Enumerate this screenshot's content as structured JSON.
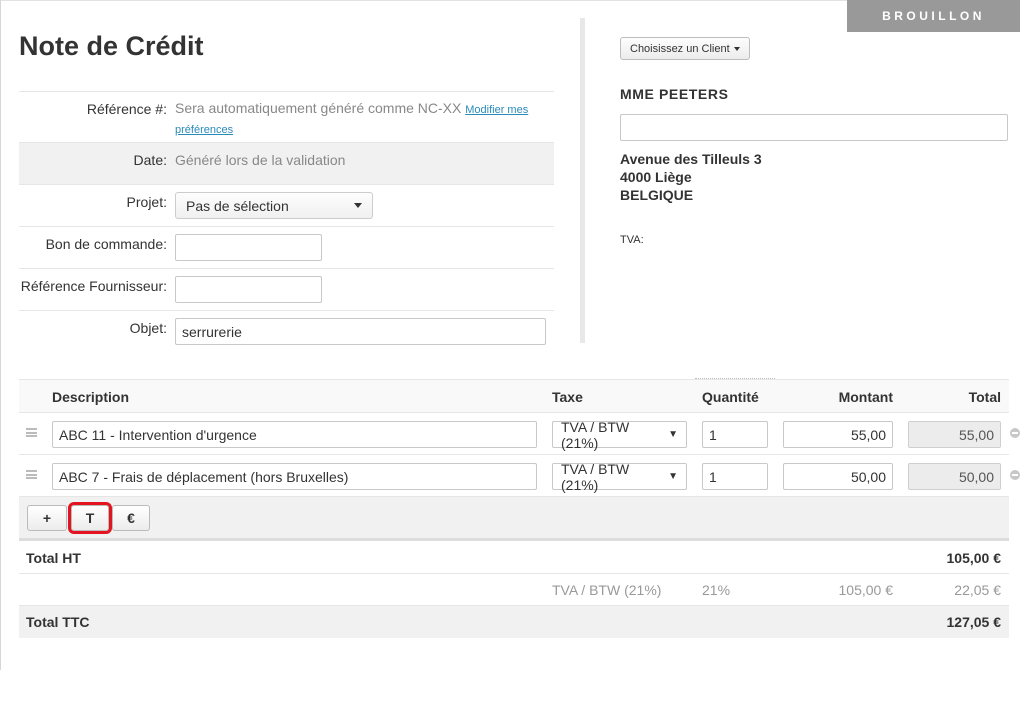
{
  "status": "BROUILLON",
  "title": "Note de Crédit",
  "form": {
    "reference_label": "Référence #:",
    "reference_text": "Sera automatiquement généré comme NC-XX",
    "reference_link_1": "Modifier mes",
    "reference_link_2": "préférences",
    "date_label": "Date:",
    "date_value": "Généré lors de la validation",
    "project_label": "Projet:",
    "project_value": "Pas de sélection",
    "po_label": "Bon de commande:",
    "po_value": "",
    "supplier_ref_label": "Référence Fournisseur:",
    "supplier_ref_value": "",
    "subject_label": "Objet:",
    "subject_value": "serrurerie"
  },
  "client": {
    "choose_button": "Choisissez un Client",
    "name": "MME PEETERS",
    "field_value": "",
    "address_1": "Avenue des Tilleuls 3",
    "address_2": "4000 Liège",
    "address_3": "BELGIQUE",
    "tva_label": "TVA:"
  },
  "lines": {
    "headers": {
      "description": "Description",
      "tax": "Taxe",
      "quantity": "Quantité",
      "amount": "Montant",
      "total": "Total"
    },
    "rows": [
      {
        "description": "ABC 11 - Intervention d'urgence",
        "tax": "TVA / BTW (21%)",
        "quantity": "1",
        "amount": "55,00",
        "total": "55,00"
      },
      {
        "description": "ABC 7 - Frais de déplacement (hors Bruxelles)",
        "tax": "TVA / BTW (21%)",
        "quantity": "1",
        "amount": "50,00",
        "total": "50,00"
      }
    ],
    "buttons": {
      "add": "+",
      "text": "T",
      "price": "€"
    }
  },
  "totals": {
    "ht_label": "Total HT",
    "ht_value": "105,00 €",
    "tva_name": "TVA / BTW (21%)",
    "tva_rate": "21%",
    "tva_base": "105,00 €",
    "tva_amount": "22,05 €",
    "ttc_label": "Total TTC",
    "ttc_value": "127,05 €"
  },
  "icons": {
    "drag": "drag-handle-icon",
    "remove": "remove-circle-icon",
    "caret": "caret-down-icon"
  },
  "colors": {
    "ribbon": "#999999",
    "link": "#2a8ab8",
    "highlight": "#e3141f"
  }
}
